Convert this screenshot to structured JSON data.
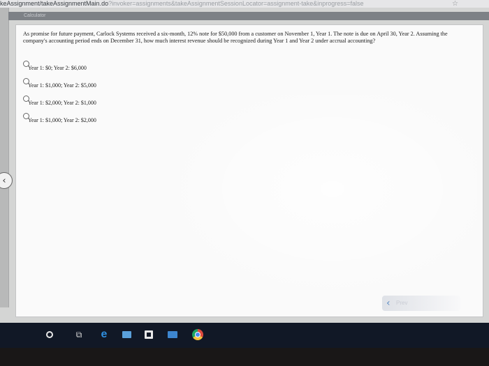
{
  "browser": {
    "url_path": "keAssignment/takeAssignmentMain.do",
    "url_query": "?invoker=assignments&takeAssignmentSessionLocator=assignment-take&inprogress=false"
  },
  "toolbar": {
    "calculator_label": "Calculator"
  },
  "question": {
    "text": "As promise for future payment, Carlock Systems received a six-month, 12% note for $50,000 from a customer on November 1, Year 1. The note is due on April 30, Year 2. Assuming the company's accounting period ends on December 31, how much interest revenue should be recognized during Year 1 and Year 2 under accrual accounting?",
    "options": [
      {
        "label": "Year 1: $0; Year 2: $6,000"
      },
      {
        "label": "Year 1: $1,000; Year 2: $5,000"
      },
      {
        "label": "Year 1: $2,000; Year 2: $1,000"
      },
      {
        "label": "Year 1: $1,000; Year 2: $2,000"
      }
    ]
  },
  "navigation": {
    "prev_label": "Prev"
  },
  "icons": {
    "star": "star-icon",
    "side_arrow": "chevron-left-icon",
    "prev_chevron": "chevron-left-icon"
  },
  "colors": {
    "accent": "#5f8ec4",
    "taskbar": "#111826"
  }
}
